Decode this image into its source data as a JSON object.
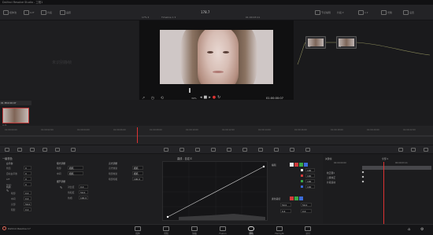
{
  "window": {
    "title": "DaVinci Resolve Studio - 工程1",
    "menus": [
      "DaVinci Resolve",
      "文件",
      "编辑",
      "修剪",
      "时间线",
      "片段",
      "标记",
      "显示",
      "回放",
      "Fusion",
      "调色",
      "Fairlight",
      "工作区",
      "帮助"
    ]
  },
  "toolbar": {
    "left_items": [
      "媒体池",
      "LUT",
      "片段",
      "画廊"
    ],
    "zoom": "17% ▾",
    "timeline_name": "Timeline 1 ▾",
    "timecode_top": "01:00:03:11",
    "center_title": "178.7",
    "right_items": [
      "节点编辑",
      "1 ▾",
      "光箱",
      "设置"
    ],
    "mode": "片段 ▾"
  },
  "gallery": {
    "watermark": "未识别静帧"
  },
  "viewer": {
    "timecode": "01:00:00:07",
    "zoom": "39%"
  },
  "nodes": [
    {
      "label": "01"
    },
    {
      "label": "02"
    }
  ],
  "clips": {
    "header": "01 3fk0 00:07",
    "label": "片段"
  },
  "timeline": {
    "ticks": [
      "01:00:00:00",
      "01:00:02:00",
      "01:00:04:00",
      "01:00:06:00",
      "01:00:08:00",
      "01:00:10:00",
      "01:00:12:00",
      "01:00:14:00",
      "01:00:16:00",
      "01:00:18:00",
      "01:00:20:00",
      "01:00:22:00"
    ]
  },
  "primaries": {
    "title": "一级校色",
    "sub1": "白平衡",
    "rows1": [
      {
        "k": "色温",
        "v": "0"
      },
      {
        "k": "自动白平衡",
        "v": "0"
      },
      {
        "k": "Lift",
        "v": "0"
      },
      {
        "k": "Gain",
        "v": "0"
      }
    ],
    "sub2": "色调",
    "rows2": [
      {
        "k": "暗部",
        "v": "0.0"
      },
      {
        "k": "中间",
        "v": "0.0"
      },
      {
        "k": "亮部",
        "v": "50.0"
      },
      {
        "k": "阴影",
        "v": "0.0"
      }
    ],
    "title2": "曝光调整",
    "rows3": [
      {
        "k": "暗部",
        "v": "相机"
      },
      {
        "k": "中间",
        "v": "相机"
      }
    ],
    "title3": "细节调整",
    "rows4": [
      {
        "k": "对比度",
        "v": "0.0"
      },
      {
        "k": "饱和度",
        "v": "50.0"
      },
      {
        "k": "色相",
        "v": "100.0"
      }
    ],
    "title4": "高光调整",
    "rows5": [
      {
        "k": "高光恢复",
        "v": "相机"
      },
      {
        "k": "暗部恢复",
        "v": "相机"
      },
      {
        "k": "暗部饱和",
        "v": "100.0"
      }
    ]
  },
  "curves": {
    "title": "曲线 - 自定义",
    "channel_title": "编辑",
    "values": [
      "100",
      "100",
      "100",
      "100"
    ],
    "soft_title": "柔化裁切",
    "soft_low": "50.0",
    "soft_high": "50.0",
    "soft_low2": "0.4",
    "soft_high2": "0.0"
  },
  "keyframes": {
    "title": "关键帧",
    "mode": "全部 ▾",
    "timecode": "00:00:00:00",
    "timecode2": "00:00:03:11",
    "tracks": [
      "校正器1",
      "二级校正",
      "片段运动"
    ]
  },
  "pages": [
    {
      "label": "媒体"
    },
    {
      "label": "剪辑"
    },
    {
      "label": "快编"
    },
    {
      "label": "Fusion"
    },
    {
      "label": "调色"
    },
    {
      "label": "Fairlight"
    },
    {
      "label": "交付"
    }
  ],
  "footer": {
    "app": "DaVinci Resolve 17"
  },
  "colors": {
    "accent": "#d33a3a",
    "active_page": "#e0e0e0"
  }
}
